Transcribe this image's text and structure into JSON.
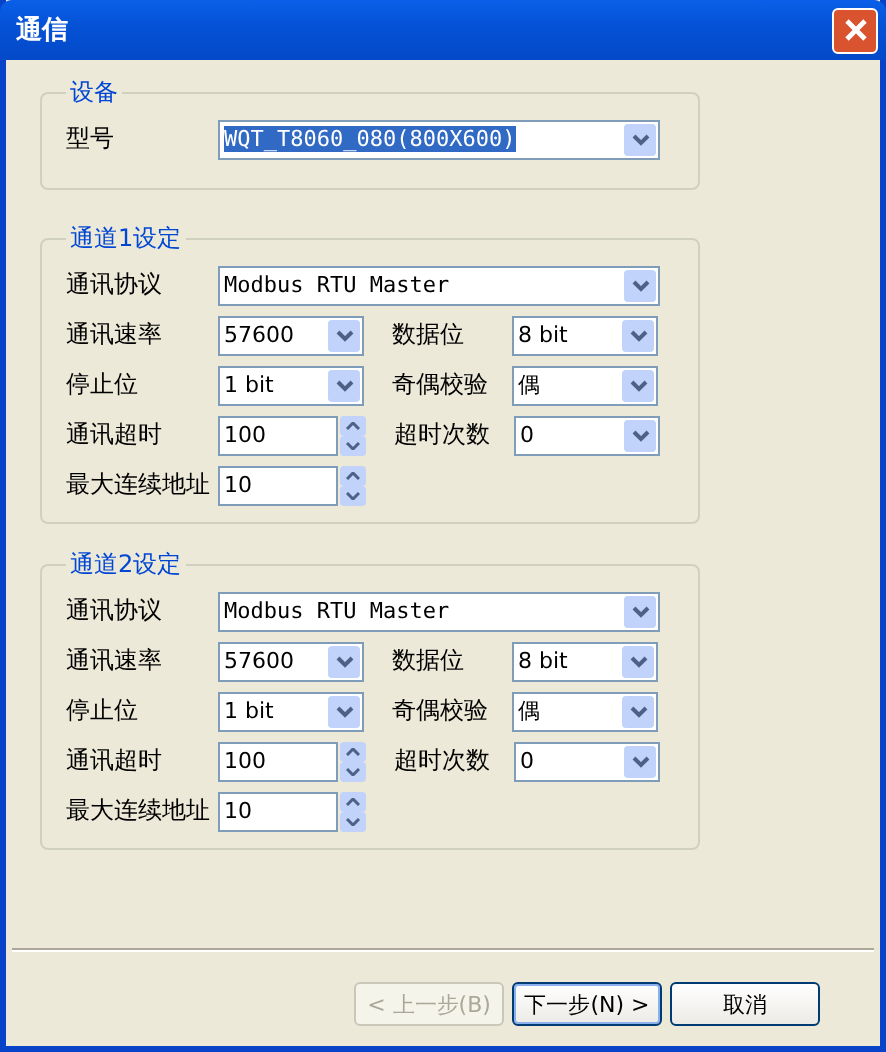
{
  "window": {
    "title": "通信"
  },
  "device": {
    "title": "设备",
    "label": "型号",
    "value": "WQT_T8060_080(800X600)",
    "highlighted": true
  },
  "channels": [
    {
      "title": "通道1设定",
      "rows": [
        [
          {
            "kind": "combo_wide",
            "label": "通讯协议",
            "value": "Modbus RTU Master"
          }
        ],
        [
          {
            "kind": "combo",
            "label": "通讯速率",
            "value": "57600"
          },
          {
            "kind": "combo",
            "label": "数据位",
            "value": "8 bit"
          }
        ],
        [
          {
            "kind": "combo",
            "label": "停止位",
            "value": "1 bit"
          },
          {
            "kind": "combo",
            "label": "奇偶校验",
            "value": "偶"
          }
        ],
        [
          {
            "kind": "spin",
            "label": "通讯超时",
            "value": "100"
          },
          {
            "kind": "combo",
            "label": "超时次数",
            "value": "0"
          }
        ],
        [
          {
            "kind": "spin",
            "label": "最大连续地址",
            "value": "10"
          }
        ]
      ]
    },
    {
      "title": "通道2设定",
      "rows": [
        [
          {
            "kind": "combo_wide",
            "label": "通讯协议",
            "value": "Modbus RTU Master"
          }
        ],
        [
          {
            "kind": "combo",
            "label": "通讯速率",
            "value": "57600"
          },
          {
            "kind": "combo",
            "label": "数据位",
            "value": "8 bit"
          }
        ],
        [
          {
            "kind": "combo",
            "label": "停止位",
            "value": "1 bit"
          },
          {
            "kind": "combo",
            "label": "奇偶校验",
            "value": "偶"
          }
        ],
        [
          {
            "kind": "spin",
            "label": "通讯超时",
            "value": "100"
          },
          {
            "kind": "combo",
            "label": "超时次数",
            "value": "0"
          }
        ],
        [
          {
            "kind": "spin",
            "label": "最大连续地址",
            "value": "10"
          }
        ]
      ]
    }
  ],
  "buttons": [
    {
      "label": "< 上一步(B)",
      "disabled": true,
      "default": false
    },
    {
      "label": "下一步(N) >",
      "disabled": false,
      "default": true
    },
    {
      "label": "取消",
      "disabled": false,
      "default": false
    }
  ]
}
